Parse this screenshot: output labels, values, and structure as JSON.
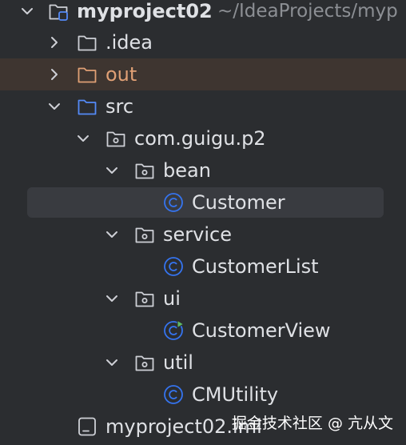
{
  "tree": {
    "items": [
      {
        "label": "myproject02",
        "path": "~/IdeaProjects/myp",
        "icon": "module-folder-icon",
        "expanded": true
      },
      {
        "label": ".idea",
        "icon": "folder-icon",
        "expanded": false
      },
      {
        "label": "out",
        "icon": "excluded-folder-icon",
        "expanded": false
      },
      {
        "label": "src",
        "icon": "source-folder-icon",
        "expanded": true
      },
      {
        "label": "com.guigu.p2",
        "icon": "package-icon",
        "expanded": true
      },
      {
        "label": "bean",
        "icon": "package-icon",
        "expanded": true
      },
      {
        "label": "Customer",
        "icon": "class-icon",
        "selected": true
      },
      {
        "label": "service",
        "icon": "package-icon",
        "expanded": true
      },
      {
        "label": "CustomerList",
        "icon": "class-icon"
      },
      {
        "label": "ui",
        "icon": "package-icon",
        "expanded": true
      },
      {
        "label": "CustomerView",
        "icon": "runnable-class-icon"
      },
      {
        "label": "util",
        "icon": "package-icon",
        "expanded": true
      },
      {
        "label": "CMUtility",
        "icon": "class-icon"
      },
      {
        "label": "myproject02.iml",
        "icon": "iml-file-icon"
      }
    ]
  },
  "watermark": {
    "text": "掘金技术社区 @ 亢从文"
  },
  "colors": {
    "background": "#2b2d30",
    "selection": "#393b40",
    "excluded_row": "#3e3530",
    "text": "#dfe1e5",
    "muted_text": "#8c8f94",
    "excluded_text": "#e0a075",
    "source_blue": "#548af7",
    "class_blue": "#3574f0",
    "run_green": "#5fb865"
  }
}
